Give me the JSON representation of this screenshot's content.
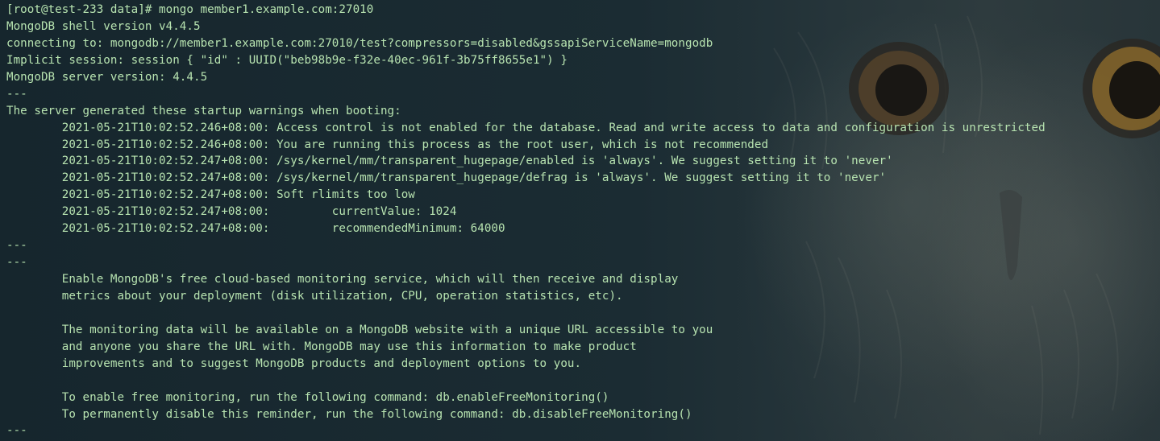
{
  "terminal": {
    "background_color": "#1b2c33",
    "text_color": "#b7e3b0",
    "lines": [
      "[root@test-233 data]# mongo member1.example.com:27010",
      "MongoDB shell version v4.4.5",
      "connecting to: mongodb://member1.example.com:27010/test?compressors=disabled&gssapiServiceName=mongodb",
      "Implicit session: session { \"id\" : UUID(\"beb98b9e-f32e-40ec-961f-3b75ff8655e1\") }",
      "MongoDB server version: 4.4.5",
      "---",
      "The server generated these startup warnings when booting:",
      "        2021-05-21T10:02:52.246+08:00: Access control is not enabled for the database. Read and write access to data and configuration is unrestricted",
      "        2021-05-21T10:02:52.246+08:00: You are running this process as the root user, which is not recommended",
      "        2021-05-21T10:02:52.247+08:00: /sys/kernel/mm/transparent_hugepage/enabled is 'always'. We suggest setting it to 'never'",
      "        2021-05-21T10:02:52.247+08:00: /sys/kernel/mm/transparent_hugepage/defrag is 'always'. We suggest setting it to 'never'",
      "        2021-05-21T10:02:52.247+08:00: Soft rlimits too low",
      "        2021-05-21T10:02:52.247+08:00:         currentValue: 1024",
      "        2021-05-21T10:02:52.247+08:00:         recommendedMinimum: 64000",
      "---",
      "---",
      "        Enable MongoDB's free cloud-based monitoring service, which will then receive and display",
      "        metrics about your deployment (disk utilization, CPU, operation statistics, etc).",
      "",
      "        The monitoring data will be available on a MongoDB website with a unique URL accessible to you",
      "        and anyone you share the URL with. MongoDB may use this information to make product",
      "        improvements and to suggest MongoDB products and deployment options to you.",
      "",
      "        To enable free monitoring, run the following command: db.enableFreeMonitoring()",
      "        To permanently disable this reminder, run the following command: db.disableFreeMonitoring()",
      "---"
    ]
  }
}
